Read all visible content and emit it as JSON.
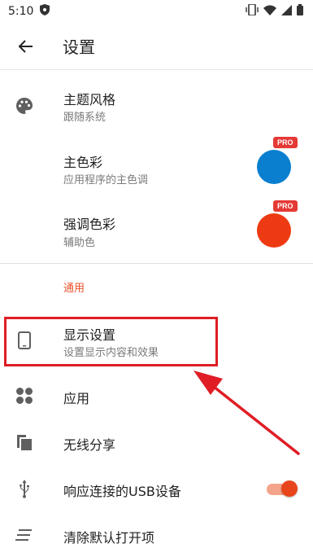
{
  "status_bar": {
    "time": "5:10",
    "icons": [
      "shield-icon",
      "vibrate-icon",
      "wifi-icon",
      "signal-icon",
      "battery-icon"
    ]
  },
  "app_bar": {
    "title": "设置",
    "back_icon": "arrow-back-icon"
  },
  "settings": {
    "theme": {
      "title": "主题风格",
      "subtitle": "跟随系统",
      "icon": "palette-icon"
    },
    "primary_color": {
      "title": "主色彩",
      "subtitle": "应用程序的主色调",
      "badge": "PRO",
      "color": "#0a7fd0"
    },
    "accent_color": {
      "title": "强调色彩",
      "subtitle": "辅助色",
      "badge": "PRO",
      "color": "#ee3a12"
    }
  },
  "section": {
    "header": "通用",
    "header_color": "#e8512a"
  },
  "general": {
    "display": {
      "title": "显示设置",
      "subtitle": "设置显示内容和效果",
      "icon": "phone-icon"
    },
    "apps": {
      "title": "应用",
      "icon": "apps-icon"
    },
    "wireless_share": {
      "title": "无线分享",
      "icon": "copy-icon"
    },
    "usb": {
      "title": "响应连接的USB设备",
      "icon": "usb-icon",
      "toggle_on": true
    },
    "clear_defaults": {
      "title": "清除默认打开项",
      "icon": "clear-all-icon"
    }
  },
  "annotation": {
    "color": "#e01d25"
  }
}
